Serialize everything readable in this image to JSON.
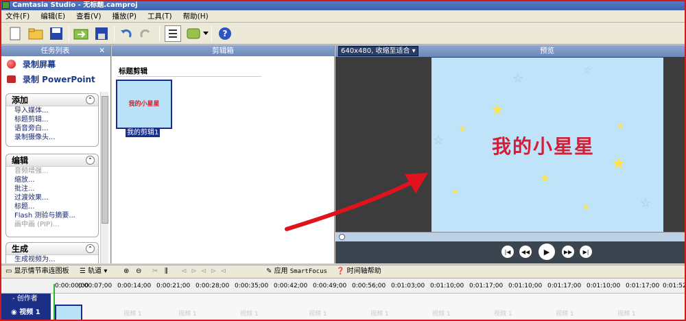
{
  "window": {
    "title": "Camtasia Studio - 无标题.camproj"
  },
  "menu": [
    "文件(F)",
    "编辑(E)",
    "查看(V)",
    "播放(P)",
    "工具(T)",
    "帮助(H)"
  ],
  "task_panel": {
    "title": "任务列表",
    "record_screen": "录制屏幕",
    "record_ppt": "录制 PowerPoint",
    "groups": [
      {
        "title": "添加",
        "items": [
          "导入媒体...",
          "标题剪辑...",
          "语音旁白...",
          "录制摄像头..."
        ]
      },
      {
        "title": "编辑",
        "items": [
          "音频增强...",
          "缩放...",
          "批注...",
          "过渡效果...",
          "标题...",
          "Flash 测验与摘要...",
          "画中画 (PIP)..."
        ]
      },
      {
        "title": "生成",
        "items": [
          "生成视频为..."
        ]
      }
    ]
  },
  "clip_bin": {
    "title": "剪辑箱",
    "section": "标题剪辑",
    "thumb_text": "我的小星星",
    "clip_caption": "我的剪辑1"
  },
  "preview": {
    "dropdown": "640x480, 收缩至适合",
    "label": "预览",
    "canvas_text": "我的小星星"
  },
  "timeline_toolbar": {
    "storyboard": "显示情节串连图板",
    "tracks": "轨道",
    "apply": "应用",
    "smartfocus": "SmartFocus",
    "help": "时间轴帮助"
  },
  "ruler": [
    "0:00:00;00",
    "0:00:07;00",
    "0:00:14;00",
    "0:00:21;00",
    "0:00:28;00",
    "0:00:35;00",
    "0:00:42;00",
    "0:00:49;00",
    "0:00:56;00",
    "0:01:03;00",
    "0:01:10;00",
    "0:01:17;00",
    "0:01:10;00",
    "0:01:17;00",
    "0:01:10;00",
    "0:01:17;00",
    "0:01:52"
  ],
  "tracks": {
    "creator": "创作者",
    "video": "视频 1",
    "video_clip_label": "视频 1"
  },
  "colors": {
    "title_gradient": "#3a62b0",
    "annotation_arrow": "#e0121e",
    "canvas_bg": "#bfe3f8",
    "track_label_bg": "#1a2f85"
  }
}
